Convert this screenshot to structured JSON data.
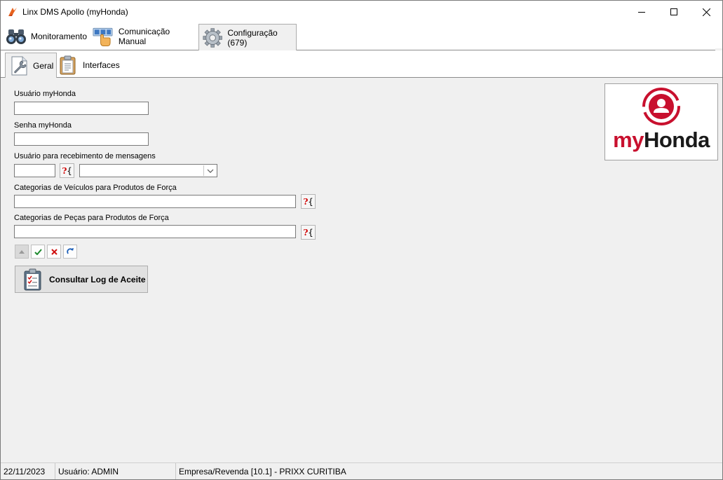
{
  "window": {
    "title": "Linx DMS Apollo (myHonda)"
  },
  "main_tabs": [
    {
      "label": "Monitoramento",
      "icon": "binoculars-icon"
    },
    {
      "label": "Comunicação Manual",
      "icon": "hand-pointer-icon"
    },
    {
      "label": "Configuração (679)",
      "icon": "gear-icon",
      "active": true
    }
  ],
  "sub_tabs": [
    {
      "label": "Geral",
      "icon": "wrench-icon",
      "active": true
    },
    {
      "label": "Interfaces",
      "icon": "clipboard-icon"
    }
  ],
  "form": {
    "usuario_label": "Usuário myHonda",
    "usuario_value": "",
    "senha_label": "Senha myHonda",
    "senha_value": "",
    "mensagens_label": "Usuário para recebimento de mensagens",
    "mensagens_code": "",
    "mensagens_select": "",
    "veiculos_label": "Categorias de Veículos para Produtos de Força",
    "veiculos_value": "",
    "pecas_label": "Categorias de Peças para Produtos de Força",
    "pecas_value": ""
  },
  "actions": {
    "consultar_label": "Consultar Log de Aceite"
  },
  "logo": {
    "my": "my",
    "honda": "Honda",
    "brand_color": "#c8102e"
  },
  "statusbar": {
    "date": "22/11/2023",
    "user": "Usuário: ADMIN",
    "company": "Empresa/Revenda [10.1] - PRIXX CURITIBA"
  }
}
